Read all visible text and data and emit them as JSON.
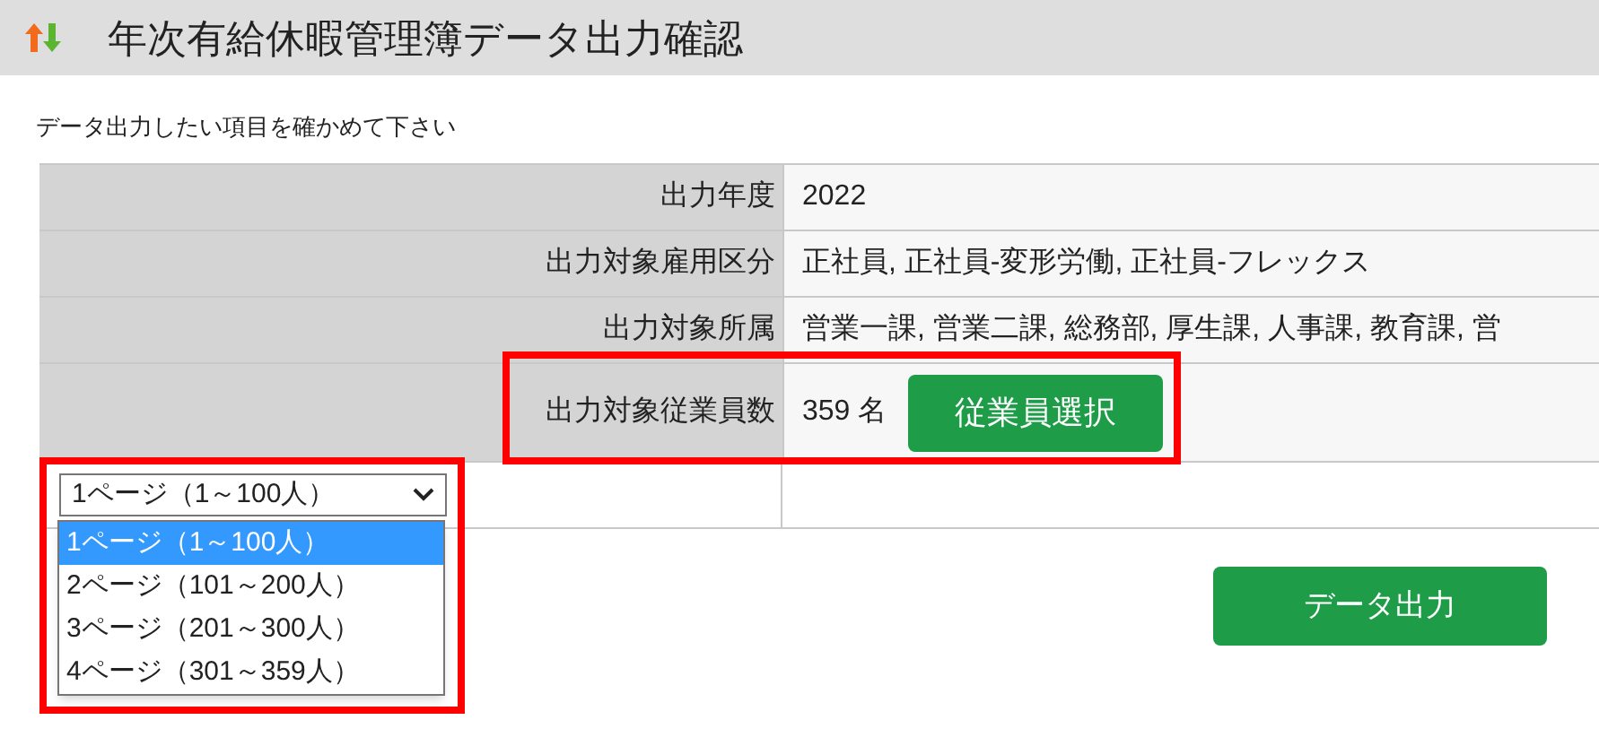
{
  "title": "年次有給休暇管理簿データ出力確認",
  "instruction": "データ出力したい項目を確かめて下さい",
  "rows": [
    {
      "kind": "text",
      "label": "出力年度",
      "value": "2022"
    },
    {
      "kind": "text",
      "label": "出力対象雇用区分",
      "value": "正社員, 正社員-変形労働, 正社員-フレックス"
    },
    {
      "kind": "text",
      "label": "出力対象所属",
      "value": "営業一課, 営業二課, 総務部, 厚生課, 人事課, 教育課, 営"
    },
    {
      "kind": "count",
      "label": "出力対象従業員数",
      "value": "359 名",
      "button": "従業員選択"
    }
  ],
  "page_select": {
    "value": "1ページ（1～100人）",
    "expanded": true,
    "options": [
      {
        "label": "1ページ（1～100人）",
        "selected": true
      },
      {
        "label": "2ページ（101～200人）",
        "selected": false
      },
      {
        "label": "3ページ（201～300人）",
        "selected": false
      },
      {
        "label": "4ページ（301～359人）",
        "selected": false
      }
    ]
  },
  "export_button": "データ出力"
}
